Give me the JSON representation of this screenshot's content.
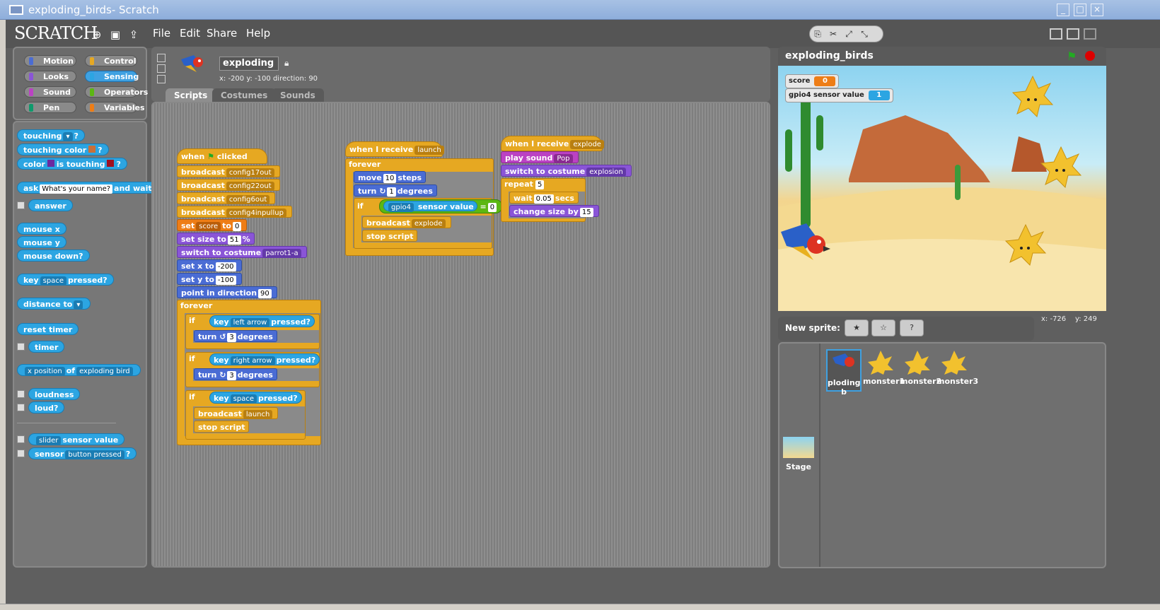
{
  "window": {
    "title": "exploding_birds- Scratch",
    "min": "_",
    "max": "□",
    "close": "×"
  },
  "menu": {
    "logo": "SCRATCH",
    "items": [
      "File",
      "Edit",
      "Share",
      "Help"
    ]
  },
  "categories": [
    {
      "label": "Motion",
      "color": "#4a6cd4"
    },
    {
      "label": "Control",
      "color": "#e6a822"
    },
    {
      "label": "Looks",
      "color": "#8a55d7"
    },
    {
      "label": "Sensing",
      "color": "#2ca5e2"
    },
    {
      "label": "Sound",
      "color": "#bb42c3"
    },
    {
      "label": "Operators",
      "color": "#5cb712"
    },
    {
      "label": "Pen",
      "color": "#0e9a6c"
    },
    {
      "label": "Variables",
      "color": "#ee7d16"
    }
  ],
  "palette": {
    "touching": "touching",
    "touching_color": "touching color",
    "color": "color",
    "is_touching": "is touching",
    "ask": "ask",
    "ask_default": "What's your name?",
    "and_wait": "and wait",
    "answer": "answer",
    "mouse_x": "mouse x",
    "mouse_y": "mouse y",
    "mouse_down": "mouse down?",
    "key": "key",
    "key_space": "space",
    "pressed": "pressed?",
    "distance_to": "distance to",
    "reset_timer": "reset timer",
    "timer": "timer",
    "x_position": "x position",
    "of": "of",
    "exploding_bird": "exploding bird",
    "loudness": "loudness",
    "loud": "loud?",
    "slider": "slider",
    "sensor_value": "sensor value",
    "sensor": "sensor",
    "button_pressed": "button pressed",
    "q": "?"
  },
  "sprite": {
    "name": "exploding bi",
    "coords": "x: -200  y: -100  direction: 90"
  },
  "tabs": [
    "Scripts",
    "Costumes",
    "Sounds"
  ],
  "script1": {
    "when": "when",
    "clicked": "clicked",
    "broadcast": "broadcast",
    "b1": "config17out",
    "b2": "config22out",
    "b3": "config6out",
    "b4": "config4inpullup",
    "set": "set",
    "score": "score",
    "to": "to",
    "zero": "0",
    "set_size": "set size to",
    "size": "51",
    "pct": "%",
    "switch": "switch to costume",
    "costume": "parrot1-a",
    "setx": "set x to",
    "xval": "-200",
    "sety": "set y to",
    "yval": "-100",
    "point": "point in direction",
    "dir": "90",
    "forever": "forever",
    "if": "if",
    "key": "key",
    "left": "left arrow",
    "right": "right arrow",
    "space": "space",
    "pressed": "pressed?",
    "turn": "turn",
    "degrees": "degrees",
    "deg": "3",
    "launch": "launch",
    "stop": "stop script"
  },
  "script2": {
    "when_receive": "when I receive",
    "launch": "launch",
    "forever": "forever",
    "move": "move",
    "steps": "steps",
    "ten": "10",
    "turn": "turn",
    "degrees": "degrees",
    "one": "1",
    "if": "if",
    "gpio4": "gpio4",
    "sensor_value": "sensor value",
    "eq": "=",
    "zero": "0",
    "broadcast": "broadcast",
    "explode": "explode",
    "stop": "stop script"
  },
  "script3": {
    "when_receive": "when I receive",
    "explode": "explode",
    "play_sound": "play sound",
    "pop": "Pop",
    "switch": "switch to costume",
    "explosion": "explosion",
    "repeat": "repeat",
    "five": "5",
    "wait": "wait",
    "secs": "secs",
    "t": "0.05",
    "change": "change size by",
    "fifteen": "15"
  },
  "stage": {
    "title": "exploding_birds",
    "mon_score": "score",
    "score_val": "0",
    "mon_gpio": "gpio4 sensor value",
    "gpio_val": "1",
    "xy_x": "x: -726",
    "xy_y": "y: 249"
  },
  "sprites": {
    "new_sprite": "New sprite:",
    "items": [
      "ploding b",
      "monster1",
      "monster2",
      "monster3"
    ],
    "stage": "Stage"
  }
}
